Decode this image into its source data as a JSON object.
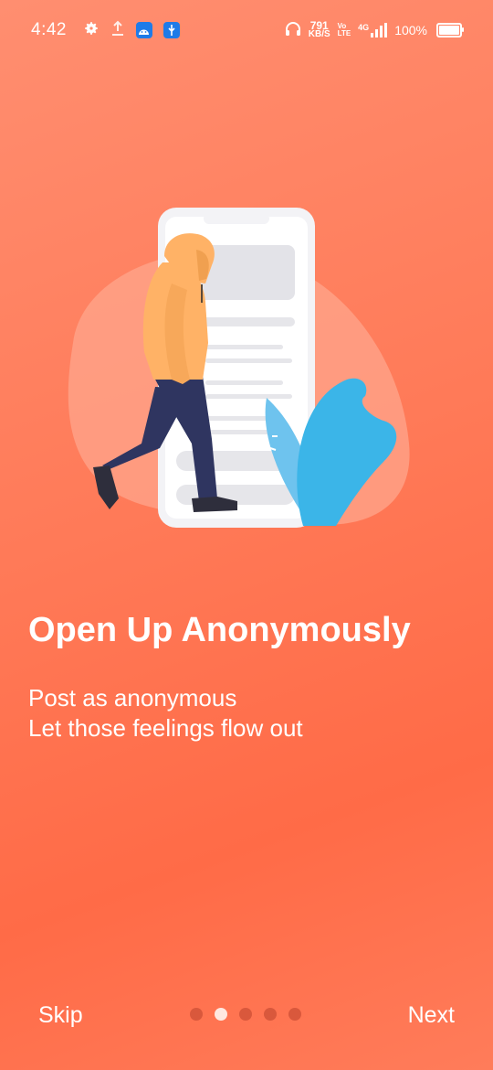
{
  "status_bar": {
    "time": "4:42",
    "net_speed_value": "791",
    "net_speed_unit": "KB/S",
    "volte_top": "Vo",
    "volte_bottom": "LTE",
    "network": "4G",
    "battery": "100%"
  },
  "onboarding": {
    "title": "Open Up Anonymously",
    "subtitle_lines": [
      "Post as anonymous",
      "Let those feelings flow out"
    ],
    "skip_label": "Skip",
    "next_label": "Next",
    "page_count": 5,
    "active_page": 2
  },
  "colors": {
    "background": "#FF7A58",
    "dot_inactive": "#D9583C",
    "dot_active": "#FFE8E0"
  }
}
